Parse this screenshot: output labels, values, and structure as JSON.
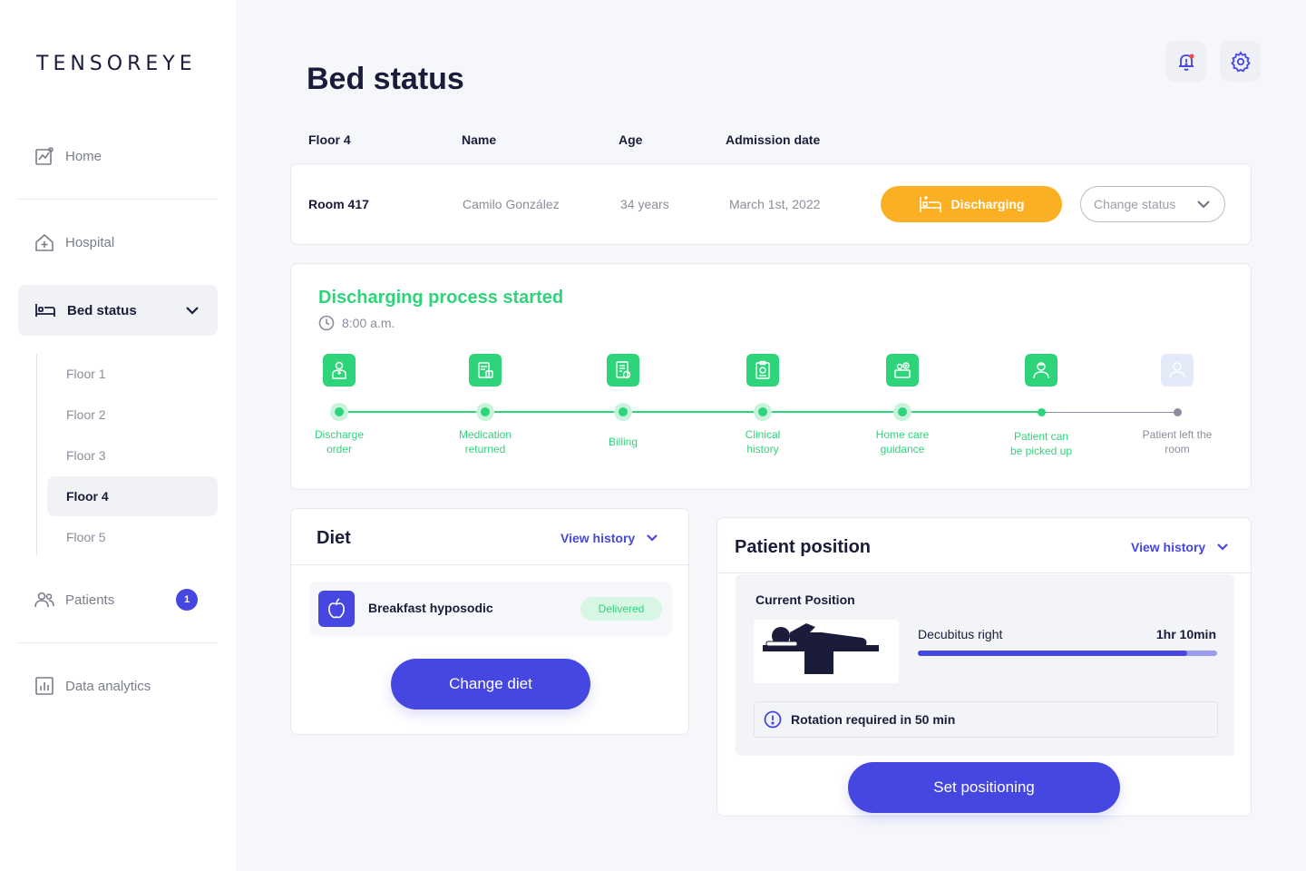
{
  "app": {
    "logo": "TENSOREYE"
  },
  "sidebar": {
    "items": [
      {
        "label": "Home",
        "icon": "chart-line-icon"
      },
      {
        "label": "Hospital",
        "icon": "hospital-icon"
      },
      {
        "label": "Bed status",
        "icon": "bed-icon"
      },
      {
        "label": "Patients",
        "icon": "users-icon",
        "badge": "1"
      },
      {
        "label": "Data analytics",
        "icon": "bar-chart-icon"
      }
    ],
    "floors": [
      "Floor 1",
      "Floor 2",
      "Floor 3",
      "Floor 4",
      "Floor 5"
    ],
    "active_floor": "Floor 4"
  },
  "header": {
    "title": "Bed status",
    "icons": [
      "bell-alert-icon",
      "gear-icon"
    ]
  },
  "table": {
    "columns": [
      "Floor 4",
      "Name",
      "Age",
      "Admission date"
    ],
    "row": {
      "room": "Room 417",
      "name": "Camilo González",
      "age": "34 years",
      "admission": "March 1st, 2022",
      "status": "Discharging",
      "change_status_placeholder": "Change status"
    }
  },
  "process": {
    "title": "Discharging process started",
    "time": "8:00 a.m.",
    "steps": [
      {
        "line1": "Discharge",
        "line2": "order",
        "done": true
      },
      {
        "line1": "Medication",
        "line2": "returned",
        "done": true
      },
      {
        "line1": "Billing",
        "line2": "",
        "done": true
      },
      {
        "line1": "Clinical",
        "line2": "history",
        "done": true
      },
      {
        "line1": "Home care",
        "line2": "guidance",
        "done": true
      },
      {
        "line1": "Patient can",
        "line2": "be picked up",
        "done": true
      },
      {
        "line1": "Patient left the",
        "line2": "room",
        "done": false
      }
    ]
  },
  "diet": {
    "title": "Diet",
    "view_history": "View history",
    "item": "Breakfast hyposodic",
    "item_status": "Delivered",
    "button": "Change diet"
  },
  "position": {
    "title": "Patient position",
    "view_history": "View history",
    "subtitle": "Current Position",
    "name": "Decubitus right",
    "duration": "1hr 10min",
    "progress_fraction": 0.9,
    "alert": "Rotation required in 50 min",
    "button": "Set positioning"
  },
  "colors": {
    "accent": "#4646e0",
    "success": "#2ed47a",
    "warning": "#fbb024",
    "text": "#1b1b3a"
  }
}
